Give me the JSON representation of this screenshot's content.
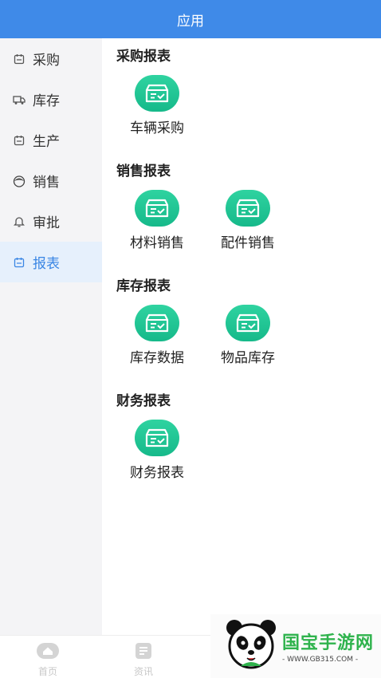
{
  "header": {
    "title": "应用"
  },
  "sidebar": {
    "items": [
      {
        "label": "采购",
        "icon": "calendar-icon"
      },
      {
        "label": "库存",
        "icon": "truck-icon"
      },
      {
        "label": "生产",
        "icon": "calendar-icon"
      },
      {
        "label": "销售",
        "icon": "person-icon"
      },
      {
        "label": "审批",
        "icon": "bell-icon"
      },
      {
        "label": "报表",
        "icon": "calendar-icon",
        "active": true
      }
    ]
  },
  "sections": [
    {
      "title": "采购报表",
      "apps": [
        {
          "label": "车辆采购",
          "icon": "report-icon"
        }
      ]
    },
    {
      "title": "销售报表",
      "apps": [
        {
          "label": "材料销售",
          "icon": "report-icon"
        },
        {
          "label": "配件销售",
          "icon": "report-icon"
        }
      ]
    },
    {
      "title": "库存报表",
      "apps": [
        {
          "label": "库存数据",
          "icon": "report-icon"
        },
        {
          "label": "物品库存",
          "icon": "report-icon"
        }
      ]
    },
    {
      "title": "财务报表",
      "apps": [
        {
          "label": "财务报表",
          "icon": "report-icon"
        }
      ]
    }
  ],
  "tabbar": {
    "items": [
      {
        "label": "首页",
        "icon": "home-icon"
      },
      {
        "label": "资讯",
        "icon": "news-icon"
      }
    ]
  },
  "watermark": {
    "name": "国宝手游网",
    "url": "- WWW.GB315.COM -",
    "icon": "panda-logo"
  },
  "colors": {
    "accent": "#3f8ae8",
    "app_icon": "#1ec596",
    "active_bg": "#e6f0fc"
  }
}
